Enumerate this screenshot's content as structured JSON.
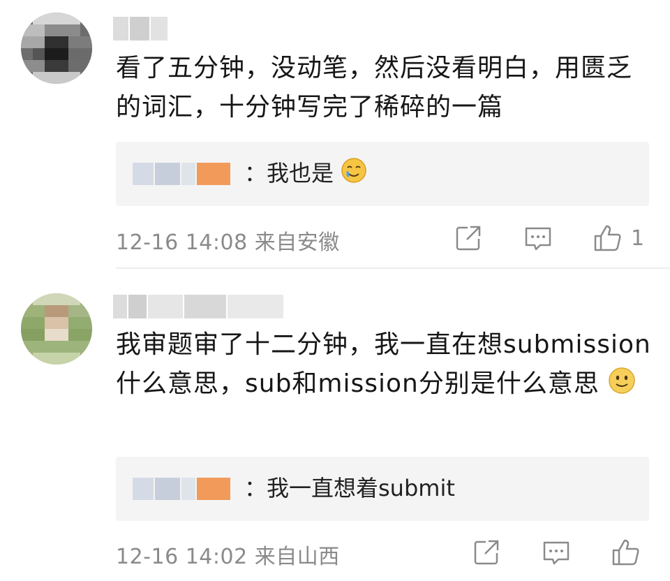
{
  "comments": [
    {
      "text": "看了五分钟，没动笔，然后没看明白，用匮乏的词汇，十分钟写完了稀碎的一篇",
      "reply": {
        "text": "：我也是",
        "emoji": "crying-smile-emoji"
      },
      "time": "12-16 14:08",
      "location": "来自安徽",
      "likes": "1"
    },
    {
      "text": "我审题审了十二分钟，我一直在想submission什么意思，sub和mission分别是什么意思",
      "emoji": "smiling-face-emoji",
      "reply": {
        "text": "：我一直想着submit"
      },
      "time": "12-16 14:02",
      "location": "来自山西",
      "likes": ""
    }
  ],
  "icons": {
    "share": "share-icon",
    "comment": "comment-icon",
    "like": "thumbs-up-icon"
  },
  "colors": {
    "meta": "#8a8a8a",
    "reply_bg": "#f4f4f4",
    "blur_orange": "#f19a5a"
  }
}
